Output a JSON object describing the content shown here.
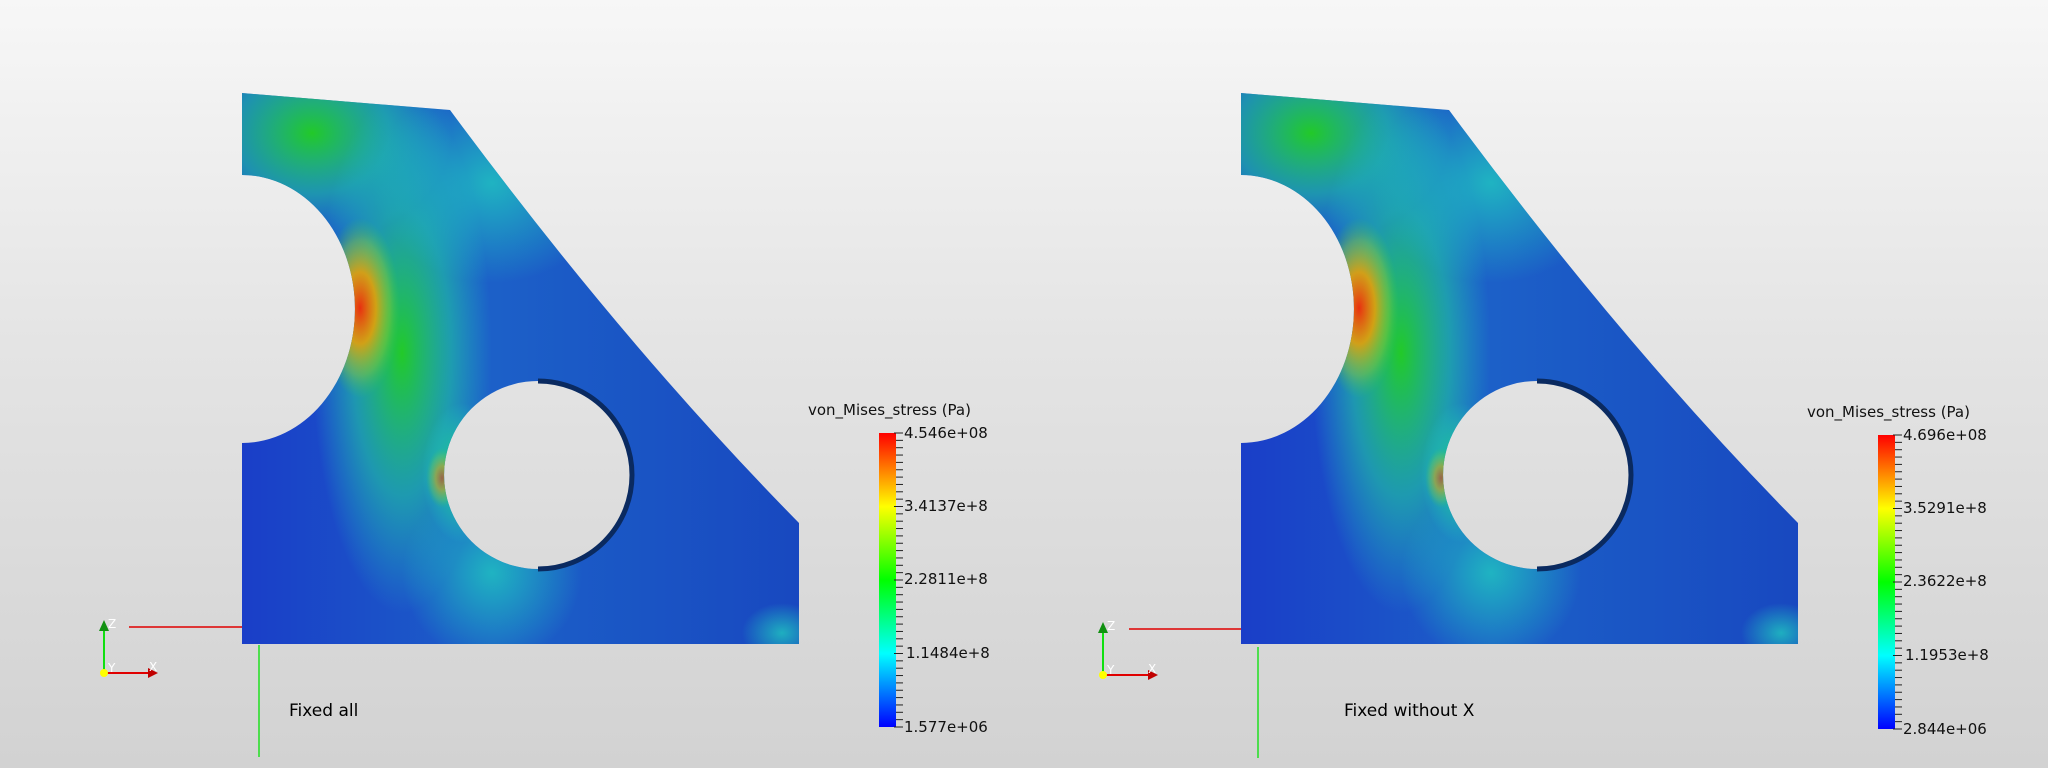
{
  "views": [
    {
      "caption": "Fixed all",
      "legend": {
        "title": "von_Mises_stress (Pa)",
        "labels": [
          "4.546e+08",
          "3.4137e+8",
          "2.2811e+8",
          "1.1484e+8",
          "1.577e+06"
        ]
      },
      "axes": {
        "x": "X",
        "y": "Y",
        "z": "Z"
      }
    },
    {
      "caption": "Fixed without X",
      "legend": {
        "title": "von_Mises_stress (Pa)",
        "labels": [
          "4.696e+08",
          "3.5291e+8",
          "2.3622e+8",
          "1.1953e+8",
          "2.844e+06"
        ]
      },
      "axes": {
        "x": "X",
        "y": "Y",
        "z": "Z"
      }
    }
  ],
  "colors": {
    "low": "#0000ff",
    "mid": "#00ff00",
    "high": "#ff0000"
  }
}
